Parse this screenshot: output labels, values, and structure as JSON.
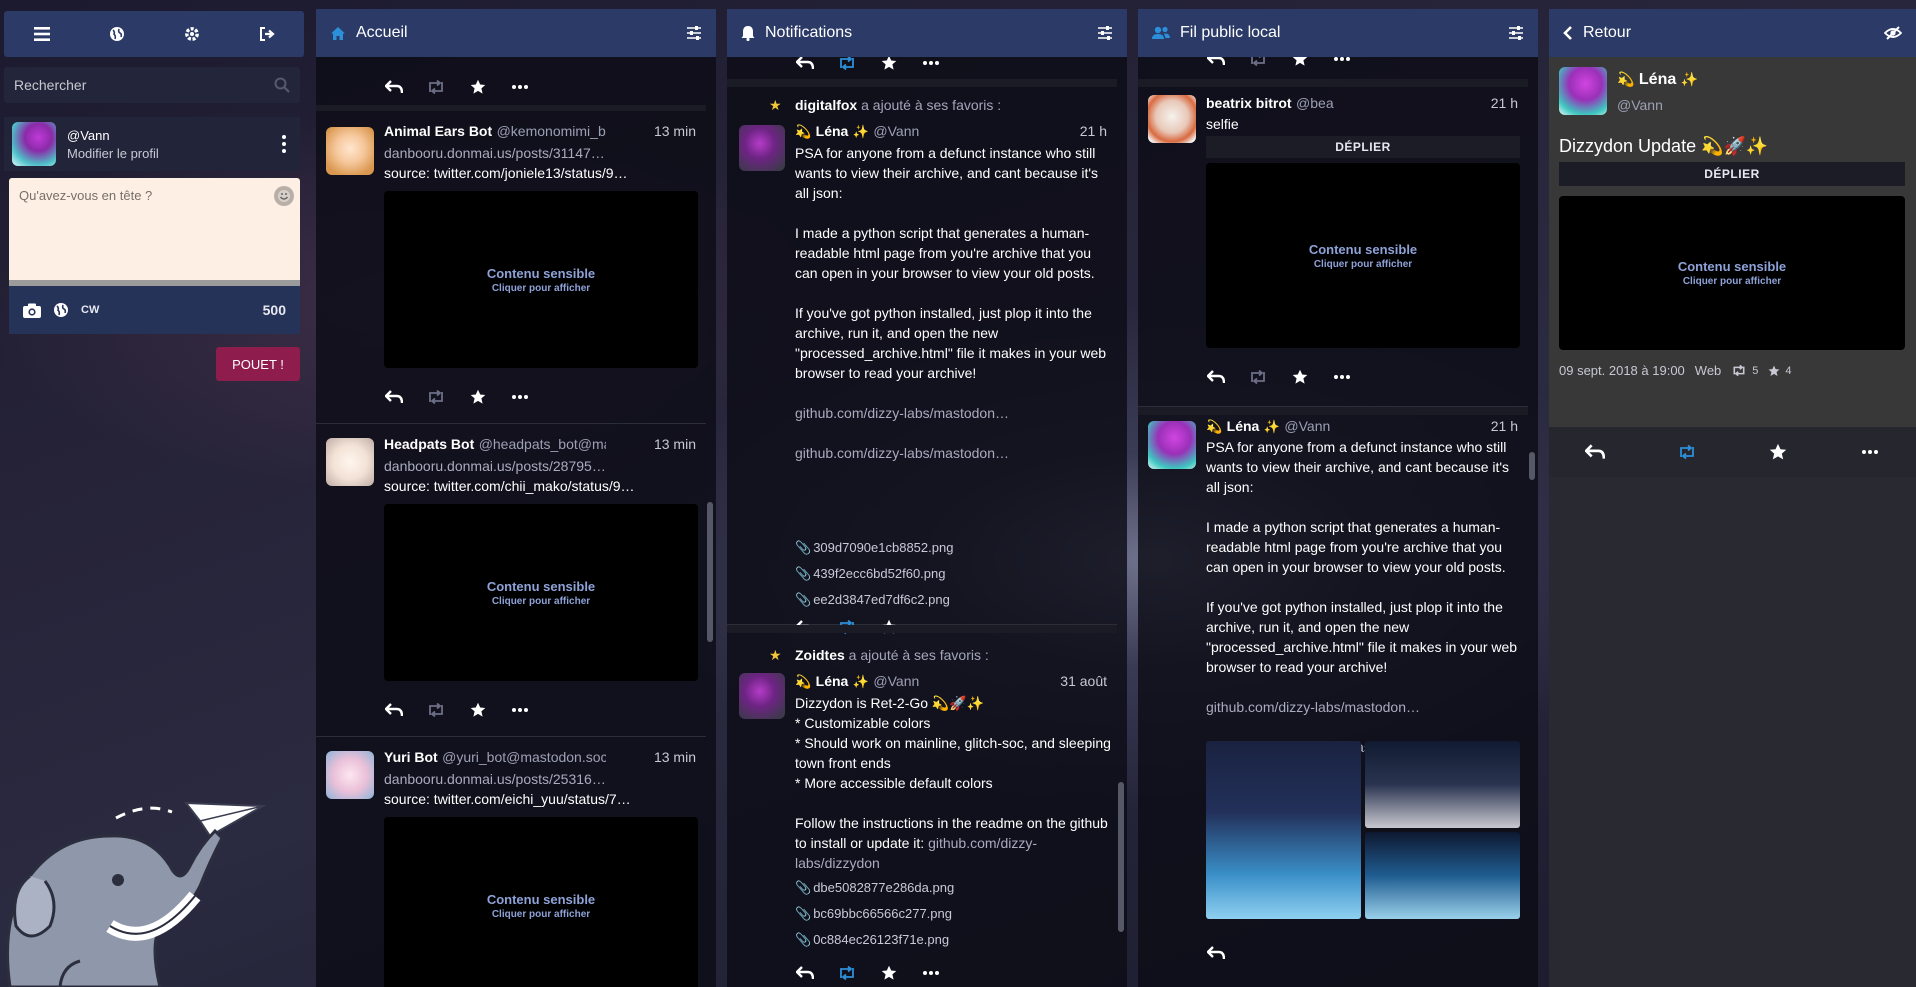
{
  "nav": {
    "icons": [
      "menu-icon",
      "globe-icon",
      "gear-icon",
      "logout-icon"
    ]
  },
  "search": {
    "placeholder": "Rechercher"
  },
  "profile": {
    "handle": "@Vann",
    "edit_label": "Modifier le profil"
  },
  "compose": {
    "placeholder": "Qu'avez-vous en tête ?",
    "cw_label": "CW",
    "char_count": "500",
    "submit_label": "POUET !"
  },
  "columns": {
    "home": {
      "title": "Accueil"
    },
    "notifications": {
      "title": "Notifications"
    },
    "local": {
      "title": "Fil public local"
    },
    "detail": {
      "title": "Retour"
    }
  },
  "sensitive": {
    "title": "Contenu sensible",
    "subtitle": "Cliquer pour afficher",
    "expand": "DÉPLIER"
  },
  "home_statuses": [
    {
      "name": "Animal Ears Bot",
      "acct": "@kemonomimi_bot@m…",
      "time": "13 min",
      "line1": "danbooru.donmai.us/posts/31147…",
      "line2": "source: twitter.com/joniele13/status/9…"
    },
    {
      "name": "Headpats Bot",
      "acct": "@headpats_bot@mastod…",
      "time": "13 min",
      "line1": "danbooru.donmai.us/posts/28795…",
      "line2": "source: twitter.com/chii_mako/status/9…"
    },
    {
      "name": "Yuri Bot",
      "acct": "@yuri_bot@mastodon.social",
      "time": "13 min",
      "line1": "danbooru.donmai.us/posts/25316…",
      "line2": "source: twitter.com/eichi_yuu/status/7…"
    }
  ],
  "notifications": [
    {
      "actor": "digitalfox",
      "action": "a ajouté à ses favoris :",
      "name": "Léna",
      "acct": "@Vann",
      "time": "21 h",
      "paragraphs": [
        "PSA for anyone from a defunct instance who still wants to view their archive, and cant because it's all json:",
        "I made a python script that generates a human-readable html page from you're archive that you can open in your browser to view your old posts.",
        "If you've got python installed, just plop it into the archive, run it, and open the new \"processed_archive.html\" file it makes in your web browser to read your archive!"
      ],
      "links": [
        "github.com/dizzy-labs/mastodon…",
        "github.com/dizzy-labs/mastodon…"
      ],
      "attachments": [
        "309d7090e1cb8852.png",
        "439f2ecc6bd52f60.png",
        "ee2d3847ed7df6c2.png"
      ]
    },
    {
      "actor": "Zoidtes",
      "action": "a ajouté à ses favoris :",
      "name": "Léna",
      "acct": "@Vann",
      "time": "31 août",
      "lines": [
        "Dizzydon is Ret-2-Go 💫🚀✨",
        "* Customizable colors",
        "* Should work on mainline, glitch-soc, and sleeping town front ends",
        "* More accessible default colors"
      ],
      "follow": "Follow the instructions in the readme on the github to install or update it:",
      "follow_link": "github.com/dizzy-labs/dizzydon",
      "attachments": [
        "dbe5082877e286da.png",
        "bc69bbc66566c277.png",
        "0c884ec26123f71e.png"
      ]
    }
  ],
  "local_statuses": [
    {
      "name": "beatrix bitrot",
      "acct": "@bea",
      "time": "21 h",
      "text": "selfie"
    },
    {
      "name": "Léna",
      "acct": "@Vann",
      "time": "21 h",
      "paragraphs": [
        "PSA for anyone from a defunct instance who still wants to view their archive, and cant because it's all json:",
        "I made a python script that generates a human-readable html page from you're archive that you can open in your browser to view your old posts.",
        "If you've got python installed, just plop it into the archive, run it, and open the new \"processed_archive.html\" file it makes in your web browser to read your archive!"
      ],
      "links": [
        "github.com/dizzy-labs/mastodon…",
        "github.com/dizzy-labs/mastodon…"
      ]
    }
  ],
  "detail": {
    "name": "Léna",
    "acct": "@Vann",
    "cw": "Dizzydon Update 💫🚀✨",
    "date": "09 sept. 2018 à 19:00",
    "app": "Web",
    "boosts": "5",
    "favs": "4"
  },
  "colors": {
    "header": "#2b3a66",
    "accent": "#2b90d9",
    "pouet": "#8e1c4d",
    "star": "#f2c63b"
  }
}
